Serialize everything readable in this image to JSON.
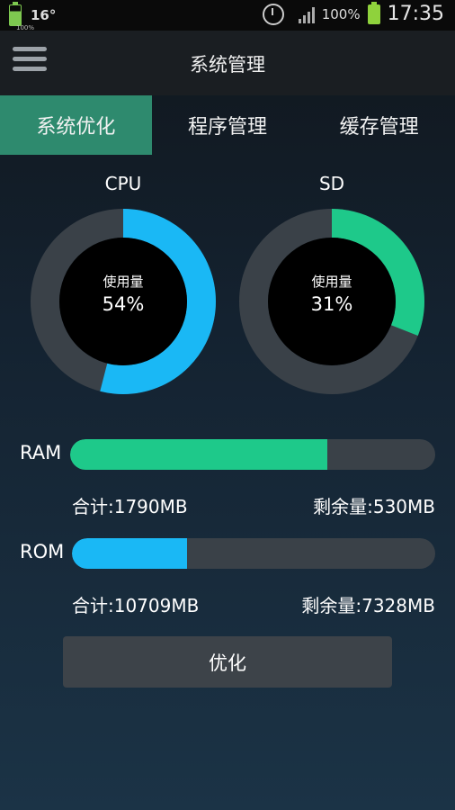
{
  "status_bar": {
    "battery_small_label": "100%",
    "temperature": "16°",
    "battery_percent": "100%",
    "time": "17:35"
  },
  "header": {
    "title": "系统管理"
  },
  "tabs": [
    {
      "label": "系统优化",
      "active": true
    },
    {
      "label": "程序管理",
      "active": false
    },
    {
      "label": "缓存管理",
      "active": false
    }
  ],
  "gauges": [
    {
      "title": "CPU",
      "caption": "使用量",
      "value_text": "54%",
      "percent": 54,
      "color": "#1ab8f5"
    },
    {
      "title": "SD",
      "caption": "使用量",
      "value_text": "31%",
      "percent": 31,
      "color": "#1ec98a"
    }
  ],
  "ram": {
    "label": "RAM",
    "fraction_used": 0.704,
    "color": "#1ec98a",
    "total": "合计:1790MB",
    "remaining": "剩余量:530MB"
  },
  "rom": {
    "label": "ROM",
    "fraction_used": 0.316,
    "color": "#1ab8f5",
    "total": "合计:10709MB",
    "remaining": "剩余量:7328MB"
  },
  "optimize_button": {
    "label": "优化"
  },
  "colors": {
    "tab_active": "#2e8a6e",
    "ring_track": "#3a4148"
  }
}
